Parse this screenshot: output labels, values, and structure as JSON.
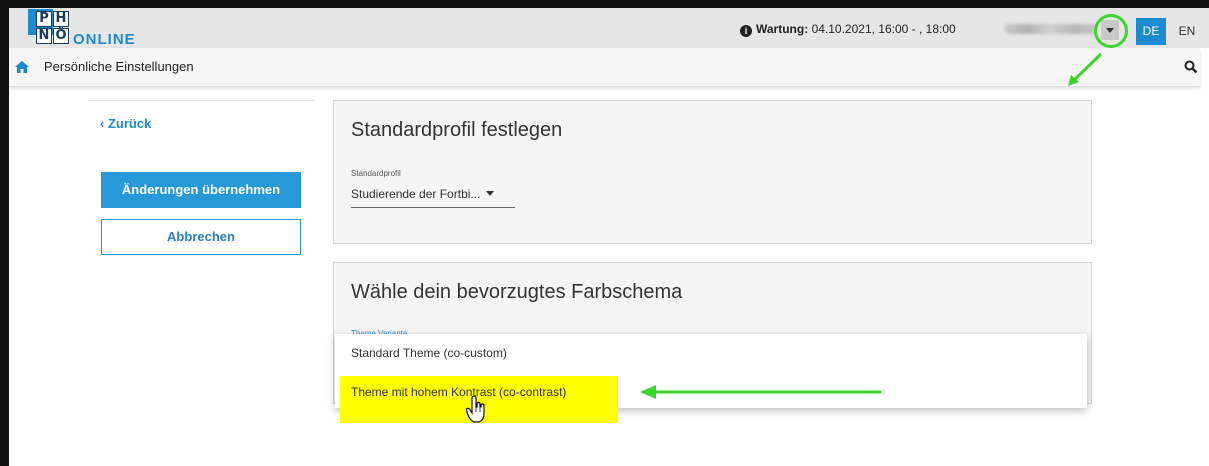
{
  "header": {
    "logo_letters": [
      "P",
      "H",
      "N",
      "Ö"
    ],
    "logo_text": "ONLINE",
    "maintenance_label": "Wartung:",
    "maintenance_value": "04.10.2021, 16:00 - , 18:00",
    "lang_de": "DE",
    "lang_en": "EN"
  },
  "subheader": {
    "title": "Persönliche Einstellungen"
  },
  "sidebar": {
    "back_label": "Zurück",
    "apply_label": "Änderungen übernehmen",
    "cancel_label": "Abbrechen"
  },
  "profile_card": {
    "title": "Standardprofil festlegen",
    "field_label": "Standardprofil",
    "field_value": "Studierende der Fortbi..."
  },
  "theme_card": {
    "title": "Wähle dein bevorzugtes Farbschema",
    "field_label": "Theme Variante",
    "options": [
      "Standard Theme (co-custom)",
      "Theme mit hohem Kontrast (co-contrast)"
    ]
  },
  "colors": {
    "accent": "#1a8bd1",
    "annotation_green": "#3cd62a",
    "highlight_yellow": "#ffff00"
  },
  "icons": [
    "info-icon",
    "caret-down-icon",
    "home-icon",
    "search-icon",
    "chevron-left-icon",
    "hand-pointer-icon"
  ]
}
